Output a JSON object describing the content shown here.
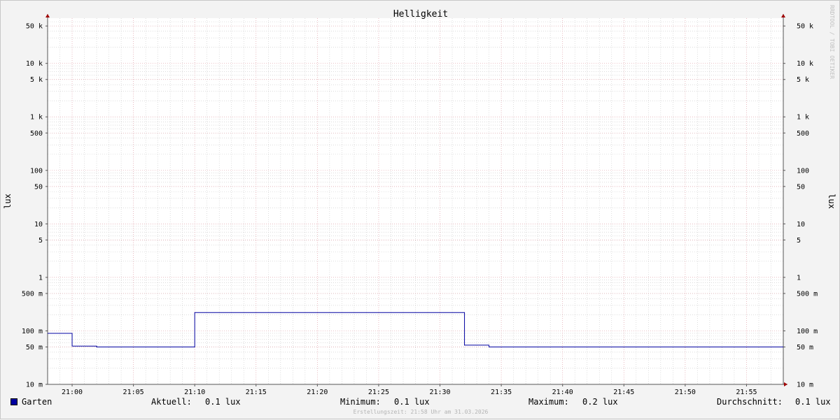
{
  "watermark": "RRDTOOL / TOBI OETIKER",
  "footer": "Erstellungszeit: 21:58 Uhr am 31.03.2026",
  "legend": {
    "series_name": "Garten",
    "current_label": "Aktuell:",
    "current_value": "0.1 lux",
    "min_label": "Minimum:",
    "min_value": "0.1 lux",
    "max_label": "Maximum:",
    "max_value": "0.2 lux",
    "avg_label": "Durchschnitt:",
    "avg_value": "0.1 lux"
  },
  "colors": {
    "series": "#0000a0",
    "major_grid": "#e0a0a8",
    "minor_grid": "#c8c8c8",
    "axis": "#555555",
    "arrow": "#a00000"
  },
  "chart_data": {
    "type": "line",
    "title": "Helligkeit",
    "ylabel": "lux",
    "y_scale": "log",
    "ylim": [
      0.01,
      70000
    ],
    "xlim": [
      "20:58",
      "21:58"
    ],
    "x_ticks": [
      "21:00",
      "21:05",
      "21:10",
      "21:15",
      "21:20",
      "21:25",
      "21:30",
      "21:35",
      "21:40",
      "21:45",
      "21:50",
      "21:55"
    ],
    "y_ticks": [
      {
        "value": 0.01,
        "label": "10 m"
      },
      {
        "value": 0.05,
        "label": "50 m"
      },
      {
        "value": 0.1,
        "label": "100 m"
      },
      {
        "value": 0.5,
        "label": "500 m"
      },
      {
        "value": 1,
        "label": "1"
      },
      {
        "value": 5,
        "label": "5"
      },
      {
        "value": 10,
        "label": "10"
      },
      {
        "value": 50,
        "label": "50"
      },
      {
        "value": 100,
        "label": "100"
      },
      {
        "value": 500,
        "label": "500"
      },
      {
        "value": 1000,
        "label": "1 k"
      },
      {
        "value": 5000,
        "label": "5 k"
      },
      {
        "value": 10000,
        "label": "10 k"
      },
      {
        "value": 50000,
        "label": "50 k"
      }
    ],
    "grid": true,
    "legend_position": "bottom",
    "series": [
      {
        "name": "Garten",
        "step": true,
        "points": [
          {
            "x": "20:58",
            "y": 0.09
          },
          {
            "x": "21:00",
            "y": 0.052
          },
          {
            "x": "21:02",
            "y": 0.05
          },
          {
            "x": "21:10",
            "y": 0.22
          },
          {
            "x": "21:32",
            "y": 0.054
          },
          {
            "x": "21:34",
            "y": 0.05
          },
          {
            "x": "21:58",
            "y": 0.05
          }
        ]
      }
    ]
  }
}
